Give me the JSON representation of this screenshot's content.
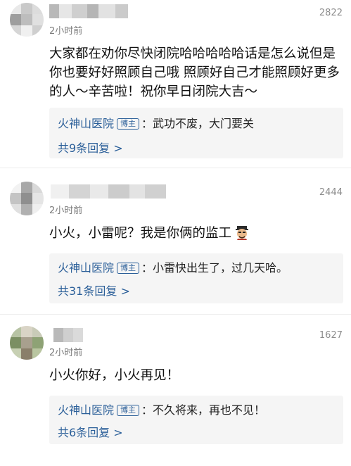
{
  "comments": [
    {
      "time": "2小时前",
      "likes": "2822",
      "text": "大家都在劝你尽快闭院哈哈哈哈哈话是怎么说但是你也要好好照顾自己哦 照顾好自己才能照顾好更多的人～辛苦啦！祝你早日闭院大吉～",
      "reply": {
        "author": "火神山医院",
        "badge": "博主",
        "content": "：武功不废，大门要关",
        "more": "共9条回复 >"
      }
    },
    {
      "time": "2小时前",
      "likes": "2444",
      "text": "小火，小雷呢？我是你俩的监工",
      "emoji": "supervisor-emoji",
      "reply": {
        "author": "火神山医院",
        "badge": "博主",
        "content": "：小雷快出生了，过几天哈。",
        "more": "共31条回复 >"
      }
    },
    {
      "time": "2小时前",
      "likes": "1627",
      "text": "小火你好，小火再见！",
      "reply": {
        "author": "火神山医院",
        "badge": "博主",
        "content": "：不久将来，再也不见！",
        "more": "共6条回复 >"
      }
    }
  ],
  "colors": {
    "link": "#2b5f99",
    "reply_bg": "#f5f5f5",
    "meta": "#7a7a7a"
  }
}
